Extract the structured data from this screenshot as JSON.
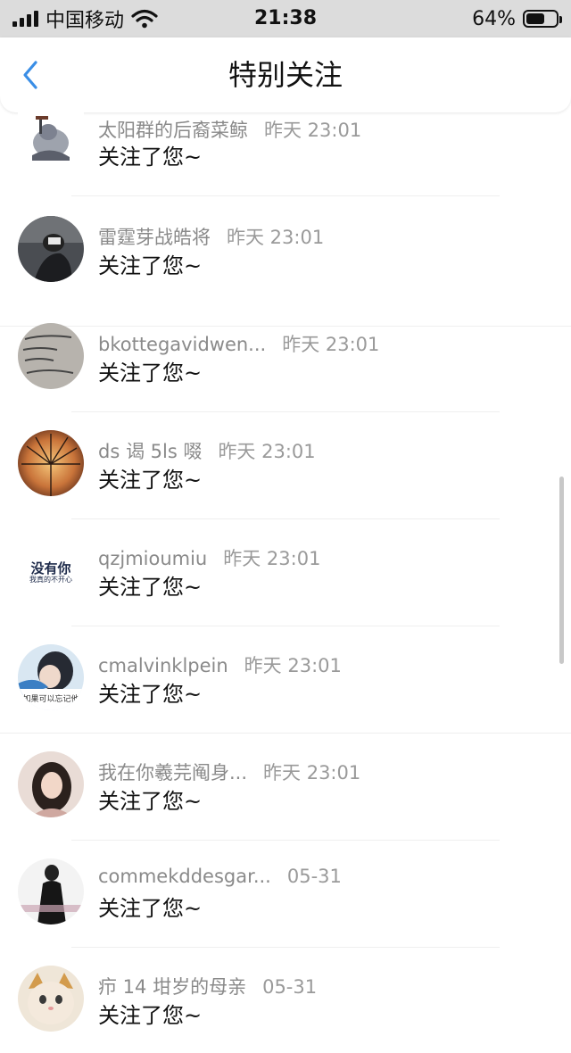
{
  "status_bar": {
    "carrier": "中国移动",
    "time": "21:38",
    "battery_percent_label": "64%",
    "battery_level": 0.64,
    "icons": [
      "signal-icon",
      "wifi-icon",
      "battery-icon"
    ]
  },
  "nav": {
    "title": "特别关注",
    "back_icon": "chevron-left-icon"
  },
  "colors": {
    "accent": "#3a8ee6",
    "status_bar_bg": "#dcdcdc",
    "name_text": "#8a8a8a",
    "message_text": "#111111"
  },
  "items": [
    {
      "name": "太阳群的后裔菜鲸",
      "time": "昨天 23:01",
      "message": "关注了您~"
    },
    {
      "name": "雷霆芽战皓将",
      "time": "昨天 23:01",
      "message": "关注了您~"
    },
    {
      "name": "bkottegavidwen...",
      "time": "昨天 23:01",
      "message": "关注了您~"
    },
    {
      "name": "ds 谒 5ls 啜",
      "time": "昨天 23:01",
      "message": "关注了您~"
    },
    {
      "name": "qzjmioumiu",
      "time": "昨天 23:01",
      "message": "关注了您~",
      "avatar_text_main": "没有你",
      "avatar_text_sub": "我真的不开心"
    },
    {
      "name": "cmalvinklpein",
      "time": "昨天 23:01",
      "message": "关注了您~",
      "avatar_text": "如果可以忘记他"
    },
    {
      "name": "我在你羲芫阄身...",
      "time": "昨天 23:01",
      "message": "关注了您~"
    },
    {
      "name": "commekddesgar...",
      "time": "05-31",
      "message": "关注了您~"
    },
    {
      "name": "疖 14 坩岁的母亲",
      "time": "05-31",
      "message": "关注了您~"
    }
  ]
}
